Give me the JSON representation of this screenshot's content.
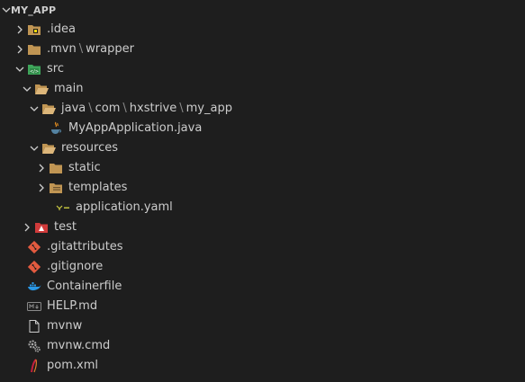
{
  "explorer": {
    "root_label": "MY_APP",
    "separator": "\\",
    "items": {
      "idea": {
        "segments": [
          ".idea"
        ]
      },
      "mvn": {
        "segments": [
          ".mvn",
          "wrapper"
        ]
      },
      "src": {
        "segments": [
          "src"
        ]
      },
      "main": {
        "segments": [
          "main"
        ]
      },
      "java": {
        "segments": [
          "java",
          "com",
          "hxstrive",
          "my_app"
        ]
      },
      "app_java": {
        "segments": [
          "MyAppApplication.java"
        ]
      },
      "resources": {
        "segments": [
          "resources"
        ]
      },
      "static": {
        "segments": [
          "static"
        ]
      },
      "templates": {
        "segments": [
          "templates"
        ]
      },
      "app_yaml": {
        "segments": [
          "application.yaml"
        ]
      },
      "test": {
        "segments": [
          "test"
        ]
      },
      "gitattributes": {
        "segments": [
          ".gitattributes"
        ]
      },
      "gitignore": {
        "segments": [
          ".gitignore"
        ]
      },
      "containerfile": {
        "segments": [
          "Containerfile"
        ]
      },
      "help_md": {
        "segments": [
          "HELP.md"
        ]
      },
      "mvnw": {
        "segments": [
          "mvnw"
        ]
      },
      "mvnw_cmd": {
        "segments": [
          "mvnw.cmd"
        ]
      },
      "pom_xml": {
        "segments": [
          "pom.xml"
        ]
      }
    }
  },
  "colors": {
    "background": "#1e1e1e",
    "text": "#cccccc",
    "folder": "#c09553",
    "git": "#e25a3f",
    "docker": "#2a98e6",
    "maven": "#c5203e",
    "java": "#e38c20",
    "src_green": "#4caf50"
  }
}
